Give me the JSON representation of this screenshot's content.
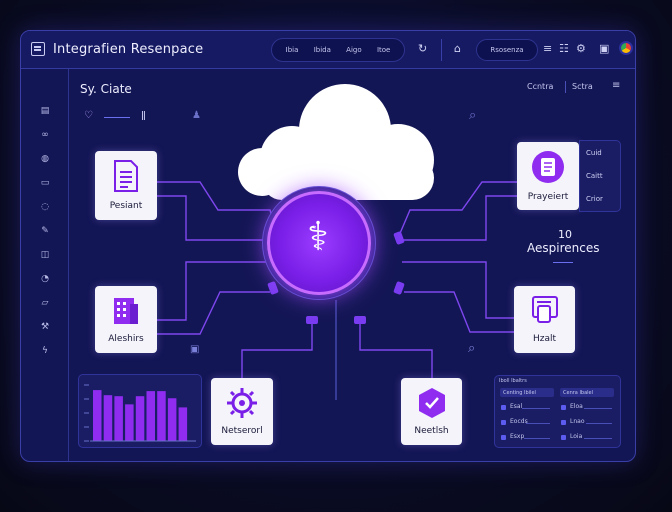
{
  "window": {
    "title": "Integrafien Resenpace",
    "tabs": [
      "Ibia",
      "Ibida",
      "Aigo",
      "Itoe"
    ],
    "button_label": "Rsosenza"
  },
  "main": {
    "title": "Sy. Ciate",
    "top_right": [
      "Ccntra",
      "Sctra"
    ],
    "stat_value": "10",
    "stat_label": "Aespirences",
    "side_list": [
      "Cuid",
      "Caitt",
      "Crior"
    ]
  },
  "cards": {
    "patient": "Pesiant",
    "prayeiert": "Prayeiert",
    "aleshirs": "Aleshirs",
    "hzalt": "Hzalt",
    "netserorl": "Netserorl",
    "neetlsh": "Neetlsh"
  },
  "list_panel": {
    "header": "Iboll Ibaltrs",
    "col_a": "Centing Ibilel",
    "col_b": "Cenra Ibalel",
    "rows_a": [
      "Esal",
      "Eocds",
      "Esxp"
    ],
    "rows_b": [
      "Eloa",
      "Lnao",
      "Loia"
    ]
  },
  "chart_data": {
    "type": "bar",
    "values": [
      50,
      45,
      44,
      36,
      44,
      49,
      49,
      42,
      33
    ],
    "ylim": [
      0,
      55
    ],
    "color": "#8f2cf0"
  },
  "colors": {
    "accent": "#9b3cff",
    "connector": "#8a4cff",
    "window_bg": "#131655"
  }
}
